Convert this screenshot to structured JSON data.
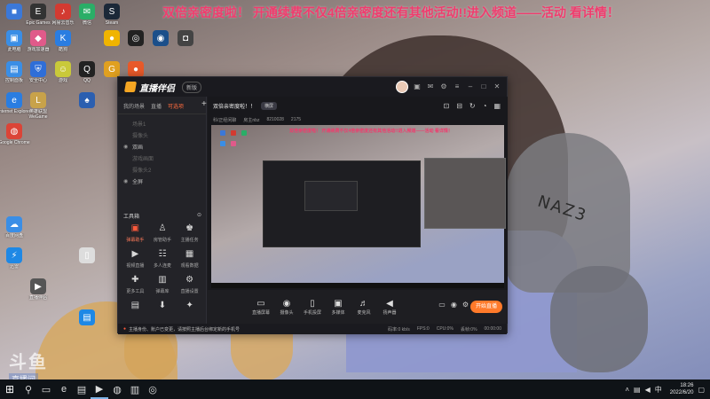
{
  "banner": {
    "text": "双倍亲密度啦！ 开通续费不仅4倍亲密度还有其他活动!!进入频道——活动 看详情！"
  },
  "wallpaper": {
    "signature": "NAZ3"
  },
  "desktop_icons": [
    {
      "label": "",
      "color": "#3b78d8",
      "glyph": "■"
    },
    {
      "label": "Epic Games",
      "color": "#333333",
      "glyph": "E"
    },
    {
      "label": "网易云音乐",
      "color": "#d33a31",
      "glyph": "♪"
    },
    {
      "label": "微信",
      "color": "#2aae67",
      "glyph": "✉"
    },
    {
      "label": "Steam",
      "color": "#1b2838",
      "glyph": "S"
    },
    {
      "label": "此电脑",
      "color": "#3a8ee6",
      "glyph": "▣"
    },
    {
      "label": "游戏加速器",
      "color": "#e05a8a",
      "glyph": "◆"
    },
    {
      "label": "酷狗",
      "color": "#2a7de1",
      "glyph": "K"
    },
    {
      "label": "",
      "color": "#f0b400",
      "glyph": "●"
    },
    {
      "label": "",
      "color": "#222222",
      "glyph": "◎"
    },
    {
      "label": "",
      "color": "#1b4f8a",
      "glyph": "◉"
    },
    {
      "label": "",
      "color": "#444444",
      "glyph": "◘"
    },
    {
      "label": "控制面板",
      "color": "#3a8ee6",
      "glyph": "▤"
    },
    {
      "label": "安全中心",
      "color": "#2f6ed8",
      "glyph": "⛨"
    },
    {
      "label": "游戏",
      "color": "#c9c93a",
      "glyph": "☺"
    },
    {
      "label": "QQ",
      "color": "#222222",
      "glyph": "Q"
    },
    {
      "label": "",
      "color": "#e0a020",
      "glyph": "G"
    },
    {
      "label": "",
      "color": "#e85a2a",
      "glyph": "●"
    },
    {
      "label": "Internet Explorer",
      "color": "#2a7de1",
      "glyph": "e"
    },
    {
      "label": "英雄联盟 WeGame",
      "color": "#c8a24a",
      "glyph": "L"
    },
    {
      "label": "",
      "color": "#2b5fb0",
      "glyph": "♠"
    },
    {
      "label": "Google Chrome",
      "color": "#db4437",
      "glyph": "◍"
    },
    {
      "label": "百度网盘",
      "color": "#3a8ee6",
      "glyph": "☁"
    },
    {
      "label": "迅雷",
      "color": "#1e88e5",
      "glyph": "⚡"
    },
    {
      "label": "",
      "color": "#dddddd",
      "glyph": "▯"
    },
    {
      "label": "直播伴侣",
      "color": "#555555",
      "glyph": "▶"
    },
    {
      "label": "",
      "color": "#1e88e5",
      "glyph": "▤"
    }
  ],
  "watermark": {
    "logo": "斗鱼",
    "tag": "直播间",
    "room": "8210028"
  },
  "app": {
    "name": "直播伴侣",
    "badge": "新版",
    "left_tabs": [
      "我的场景",
      "直播",
      "可选项"
    ],
    "scenes": [
      {
        "eye": "",
        "label": "场景1"
      },
      {
        "eye": "",
        "label": "摄像头"
      },
      {
        "eye": "◉",
        "label": "双画"
      },
      {
        "eye": "",
        "label": "游戏画面"
      },
      {
        "eye": "",
        "label": "摄像头2"
      },
      {
        "eye": "◉",
        "label": "全屏"
      }
    ],
    "tools_title": "工具箱",
    "tools": [
      {
        "icon": "▣",
        "label": "弹幕助手",
        "hot": true
      },
      {
        "icon": "♙",
        "label": "房管助手",
        "hot": false
      },
      {
        "icon": "♚",
        "label": "主播任务",
        "hot": false
      },
      {
        "icon": "▶",
        "label": "视频直播",
        "hot": false
      },
      {
        "icon": "☷",
        "label": "多人连麦",
        "hot": false
      },
      {
        "icon": "▦",
        "label": "观看数据",
        "hot": false
      },
      {
        "icon": "✚",
        "label": "更多工具",
        "hot": false
      },
      {
        "icon": "▥",
        "label": "弹幕库",
        "hot": false
      },
      {
        "icon": "⚙",
        "label": "直播设置",
        "hot": false
      },
      {
        "icon": "▤",
        "label": "",
        "hot": false
      },
      {
        "icon": "⬇",
        "label": "",
        "hot": false
      },
      {
        "icon": "✦",
        "label": "",
        "hot": false
      }
    ],
    "preview": {
      "room_title": "双倍亲密度啦！！",
      "mode": "横屏",
      "category": "科/正经闲聊",
      "host": "房主nbz",
      "room_id": "8210028",
      "viewers": "2175",
      "mini_banner": "双倍亲密度啦！ 开通续费不仅4倍亲密度还有其他活动!!进入频道——活动 看详情！"
    },
    "bottom_tools": [
      {
        "icon": "▭",
        "label": "直播屏幕"
      },
      {
        "icon": "◉",
        "label": "摄像头"
      },
      {
        "icon": "▯",
        "label": "手机投屏"
      },
      {
        "icon": "▣",
        "label": "多媒体"
      },
      {
        "icon": "♬",
        "label": "麦克风"
      },
      {
        "icon": "◀",
        "label": "扬声器"
      }
    ],
    "start_label": "开始直播",
    "status_notice": "主播身份、账户已变更，请按照主播后台绑定新的手机号",
    "status_stats": [
      "码率:0 kb/s",
      "FPS:0",
      "CPU:0%",
      "丢帧:0%",
      "00:00:00"
    ]
  },
  "taskbar": {
    "icons": [
      "⊞",
      "⚲",
      "▭",
      "e",
      "▤",
      "▶",
      "◍",
      "▥",
      "◎"
    ],
    "time": "18:26",
    "date": "2022/6/20"
  }
}
